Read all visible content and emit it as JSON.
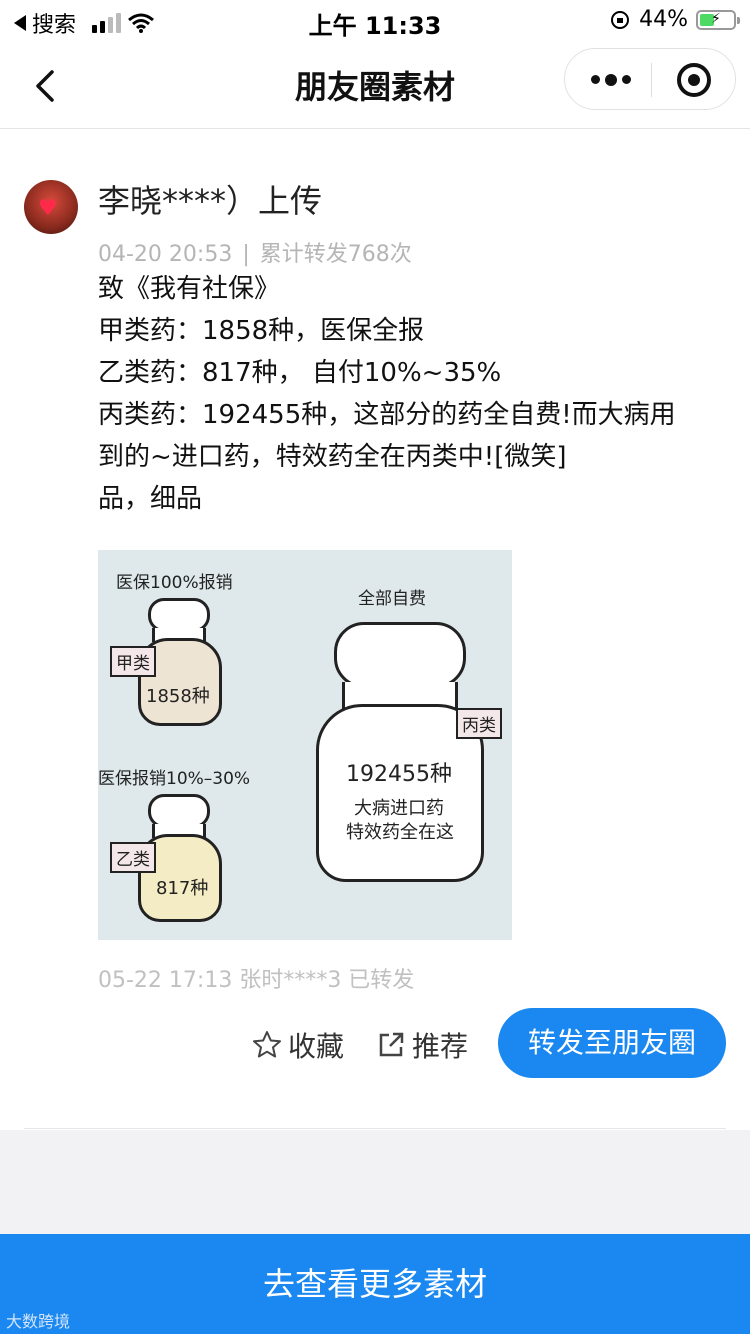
{
  "status_bar": {
    "back_app": "搜索",
    "time": "上午 11:33",
    "battery": "44%"
  },
  "nav": {
    "title": "朋友圈素材"
  },
  "post": {
    "user": "李晓****）上传",
    "date": "04-20 20:53",
    "separator": "|",
    "forward_count": "累计转发768次",
    "lines": [
      "致《我有社保》",
      "甲类药：1858种，医保全报",
      "乙类药：817种， 自付10%~35%",
      "丙类药：192455种，这部分的药全自费!而大病用",
      "到的~进口药，特效药全在丙类中![微笑]",
      "品，细品"
    ],
    "image": {
      "label_a": "医保100%报销",
      "tag_a": "甲类",
      "count_a": "1858种",
      "label_b": "医保报销10%–30%",
      "tag_b": "乙类",
      "count_b": "817种",
      "label_c": "全部自费",
      "tag_c": "丙类",
      "count_c": "192455种",
      "desc_c1": "大病进口药",
      "desc_c2": "特效药全在这"
    },
    "forward_info": "05-22 17:13 张时****3 已转发"
  },
  "actions": {
    "favorite": "收藏",
    "recommend": "推荐",
    "share": "转发至朋友圈"
  },
  "bottom_button": "去查看更多素材",
  "watermark": "大数跨境",
  "icons": {
    "back": "chevron-left-icon",
    "more": "more-dots-icon",
    "close": "target-icon",
    "favorite": "star-icon",
    "recommend": "share-out-icon"
  },
  "colors": {
    "primary": "#1a88f0",
    "meta_text": "#b5b5b5"
  }
}
